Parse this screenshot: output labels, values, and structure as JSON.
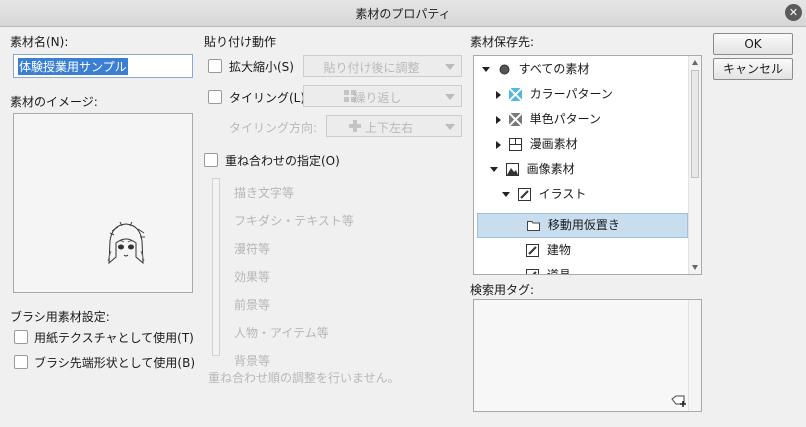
{
  "window": {
    "title": "素材のプロパティ",
    "close_glyph": "✕"
  },
  "name_section": {
    "label": "素材名(N):",
    "value": "体験授業用サンプル"
  },
  "image_section": {
    "label": "素材のイメージ:"
  },
  "brush_section": {
    "label": "ブラシ用素材設定:",
    "checkbox1": "用紙テクスチャとして使用(T)",
    "checkbox2": "ブラシ先端形状として使用(B)"
  },
  "paste_section": {
    "label": "貼り付け動作",
    "scale_checkbox": "拡大縮小(S)",
    "scale_combo": "貼り付け後に調整",
    "tiling_checkbox": "タイリング(L)",
    "tiling_combo": "繰り返し",
    "tiling_dir_label": "タイリング方向:",
    "tiling_dir_combo": "上下左右",
    "overlay_checkbox": "重ね合わせの指定(O)",
    "overlay_items": [
      "描き文字等",
      "フキダシ・テキスト等",
      "漫符等",
      "効果等",
      "前景等",
      "人物・アイテム等",
      "背景等"
    ],
    "overlay_note": "重ね合わせ順の調整を行いません。"
  },
  "save_section": {
    "label": "素材保存先:",
    "tree": [
      {
        "label": "すべての素材",
        "icon": "circle-icon",
        "expander": "down"
      },
      {
        "label": "カラーパターン",
        "icon": "color-pattern-icon",
        "expander": "right"
      },
      {
        "label": "単色パターン",
        "icon": "mono-pattern-icon",
        "expander": "right"
      },
      {
        "label": "漫画素材",
        "icon": "manga-icon",
        "expander": "right"
      },
      {
        "label": "画像素材",
        "icon": "image-icon",
        "expander": "down"
      },
      {
        "label": "イラスト",
        "icon": "pen-icon",
        "expander": "down"
      },
      {
        "label": "移動用仮置き",
        "icon": "folder-icon",
        "expander": "none",
        "selected": true
      },
      {
        "label": "建物",
        "icon": "pen-icon",
        "expander": "none"
      },
      {
        "label": "道具",
        "icon": "pen-icon",
        "expander": "none"
      }
    ]
  },
  "tag_section": {
    "label": "検索用タグ:"
  },
  "buttons": {
    "ok": "OK",
    "cancel": "キャンセル"
  }
}
